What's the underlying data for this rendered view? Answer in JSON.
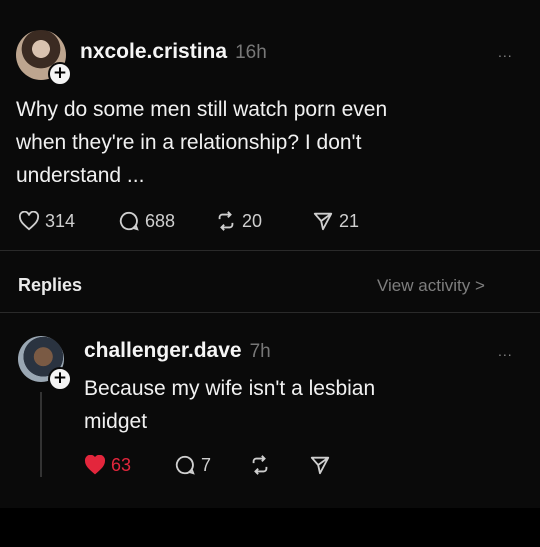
{
  "post": {
    "username": "nxcole.cristina",
    "time": "16h",
    "more": "...",
    "text_lines": [
      "Why do some men still watch porn even",
      "when they're in a relationship? I don't",
      "understand ..."
    ],
    "likes": "314",
    "comments": "688",
    "reposts": "20",
    "shares": "21"
  },
  "replies_header": {
    "title": "Replies",
    "view_activity": "View activity >"
  },
  "reply": {
    "username": "challenger.dave",
    "time": "7h",
    "more": "...",
    "text_lines": [
      "Because my wife isn't a lesbian",
      "midget"
    ],
    "likes": "63",
    "comments": "7"
  },
  "colors": {
    "background": "#0a0a0a",
    "liked_red": "#e3263c",
    "muted_gray": "#7e7e7e"
  },
  "icons": [
    "heart-icon",
    "comment-icon",
    "repost-icon",
    "share-icon",
    "follow-plus-icon",
    "more-icon"
  ]
}
